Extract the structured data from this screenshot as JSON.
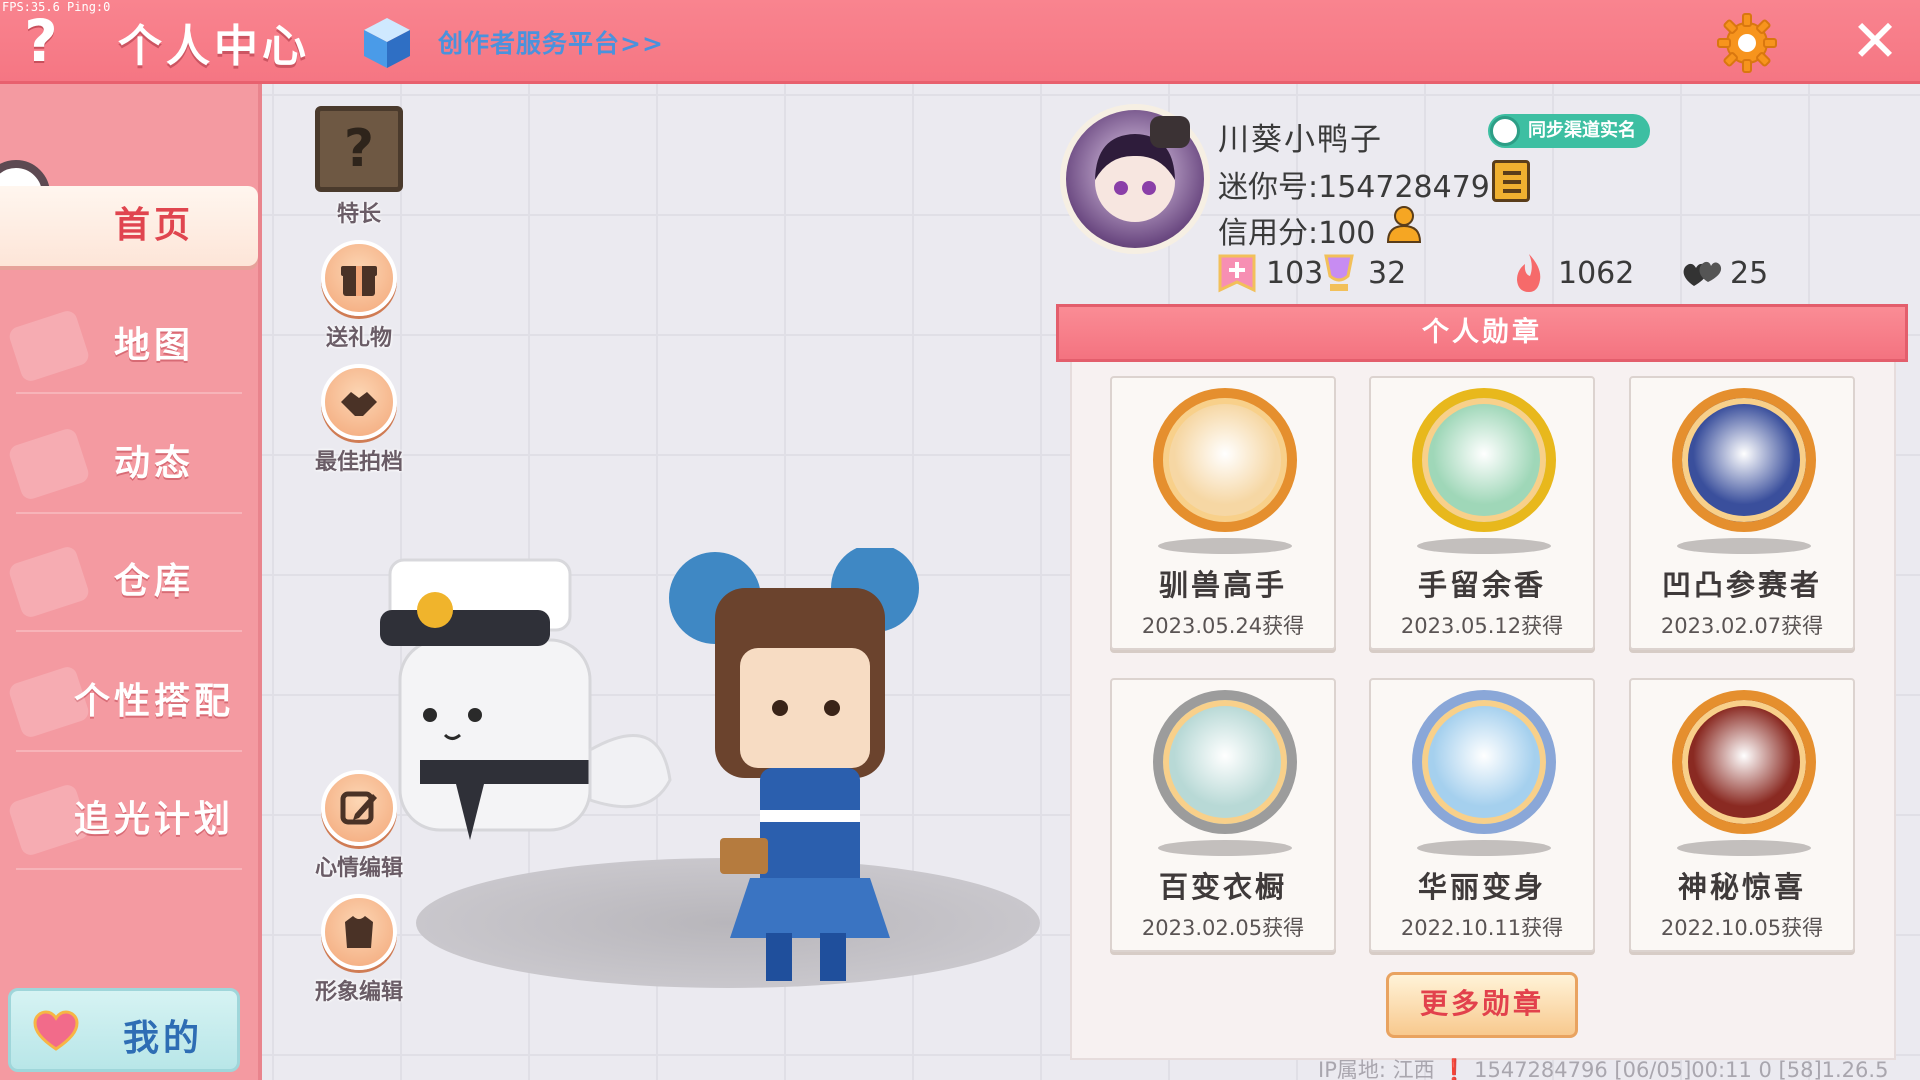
{
  "debug": {
    "fps": "FPS:35.6  Ping:0"
  },
  "topbar": {
    "title": "个人中心",
    "creator_link": "创作者服务平台>>",
    "help_symbol": "?",
    "close_symbol": "✕",
    "icons": [
      "help-icon",
      "cube-icon",
      "gear-icon",
      "close-icon"
    ]
  },
  "sidebar": {
    "items": [
      {
        "label": "首页",
        "active": true
      },
      {
        "label": "地图",
        "active": false
      },
      {
        "label": "动态",
        "active": false
      },
      {
        "label": "仓库",
        "active": false
      },
      {
        "label": "个性搭配",
        "active": false
      },
      {
        "label": "追光计划",
        "active": false
      }
    ],
    "mine_label": "我的"
  },
  "actions": {
    "specialty": {
      "label": "特长",
      "symbol": "?"
    },
    "gift": {
      "label": "送礼物"
    },
    "partner": {
      "label": "最佳拍档"
    },
    "mood_edit": {
      "label": "心情编辑"
    },
    "image_edit": {
      "label": "形象编辑"
    }
  },
  "profile": {
    "name": "川葵小鸭子",
    "realname_badge": "同步渠道实名",
    "mini_id": "迷你号:1547284796",
    "credit": "信用分:100",
    "stats": [
      {
        "icon": "flag-icon",
        "value": "103"
      },
      {
        "icon": "trophy-icon",
        "value": "32"
      },
      {
        "icon": "flame-icon",
        "value": "1062"
      },
      {
        "icon": "hearts-icon",
        "value": "25"
      }
    ]
  },
  "medals": {
    "header": "个人勋章",
    "items": [
      {
        "name": "驯兽高手",
        "date": "2023.05.24获得",
        "ring": "#e58f2e",
        "fill": "#f6d7a4"
      },
      {
        "name": "手留余香",
        "date": "2023.05.12获得",
        "ring": "#e8b81c",
        "fill": "#9fd7b8"
      },
      {
        "name": "凹凸参赛者",
        "date": "2023.02.07获得",
        "ring": "#e58f2e",
        "fill": "#3a4f9c"
      },
      {
        "name": "百变衣橱",
        "date": "2023.02.05获得",
        "ring": "#9c9c9c",
        "fill": "#b8d9d6"
      },
      {
        "name": "华丽变身",
        "date": "2022.10.11获得",
        "ring": "#8aa7d8",
        "fill": "#a5d0ee"
      },
      {
        "name": "神秘惊喜",
        "date": "2022.10.05获得",
        "ring": "#e58f2e",
        "fill": "#8a2a22"
      }
    ],
    "more_label": "更多勋章"
  },
  "footer": {
    "info": "IP属地: 江西 ❗   1547284796   [06/05]00:11 0   [58]1.26.5"
  }
}
